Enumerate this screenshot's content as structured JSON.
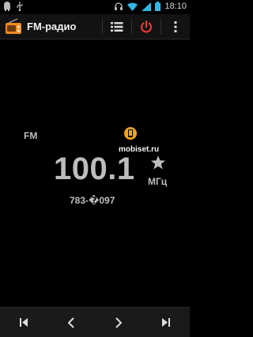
{
  "status_bar": {
    "time": "18:10",
    "icons": [
      "android-icon",
      "usb-icon",
      "headset-icon",
      "wifi-icon",
      "signal-icon",
      "battery-icon"
    ]
  },
  "action_bar": {
    "title": "FM-радио",
    "app_icon": "radio-icon",
    "buttons": [
      "list-icon",
      "power-icon",
      "overflow-menu-icon"
    ],
    "power_color": "#e53935"
  },
  "tuner": {
    "band": "FM",
    "frequency": "100.1",
    "unit": "МГц",
    "station": "783-�097",
    "favorite_icon": "star-icon"
  },
  "watermark": {
    "text": "mobiset.ru"
  },
  "bottom_bar": {
    "buttons": [
      "skip-previous-icon",
      "seek-back-icon",
      "seek-forward-icon",
      "skip-next-icon"
    ]
  }
}
